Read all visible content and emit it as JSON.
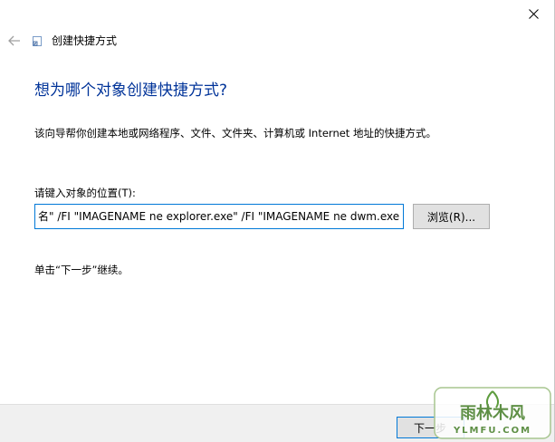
{
  "window": {
    "close_symbol": "✕"
  },
  "wizard": {
    "title": "创建快捷方式",
    "icon": "shortcut-icon",
    "back_icon": "back-arrow-icon"
  },
  "main": {
    "heading": "想为哪个对象创建快捷方式?",
    "description": "该向导帮你创建本地或网络程序、文件、文件夹、计算机或 Internet 地址的快捷方式。",
    "location_label": "请键入对象的位置(T):",
    "location_value": "名\" /FI \"IMAGENAME ne explorer.exe\" /FI \"IMAGENAME ne dwm.exe",
    "browse_label": "浏览(R)...",
    "continue_text": "单击“下一步”继续。"
  },
  "footer": {
    "next_label": "下一步"
  },
  "watermark": {
    "brand": "雨林木风",
    "url": "YLMFU.COM"
  },
  "colors": {
    "heading": "#003399",
    "focus": "#0078d7",
    "button_bg": "#e1e1e1",
    "footer_bg": "#f0f0f0"
  }
}
